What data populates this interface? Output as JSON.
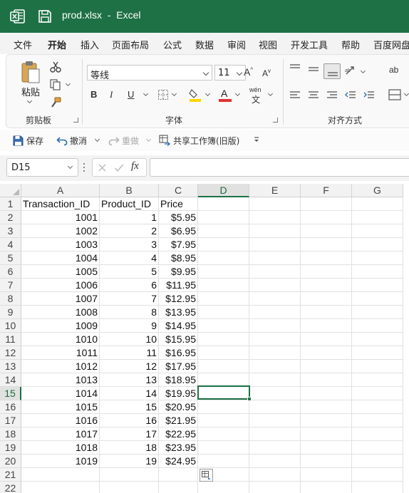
{
  "window": {
    "title": "prod.xlsx  -  Excel",
    "app_icon": "excel-icon",
    "save_icon": "save-icon"
  },
  "menu": {
    "tabs": [
      "文件",
      "开始",
      "插入",
      "页面布局",
      "公式",
      "数据",
      "审阅",
      "视图",
      "开发工具",
      "帮助",
      "百度网盘"
    ],
    "active": "开始"
  },
  "ribbon": {
    "clipboard": {
      "paste_label": "粘贴",
      "group_label": "剪贴板"
    },
    "font": {
      "font_name": "等线",
      "font_size": "11",
      "bold": "B",
      "italic": "I",
      "underline": "U",
      "grow": "A",
      "shrink": "A",
      "wen": "wén",
      "wen_char": "文",
      "group_label": "字体",
      "fill_color": "#ffd400",
      "font_color": "#e03030"
    },
    "alignment": {
      "group_label": "对齐方式",
      "wrap_label": "ab"
    }
  },
  "quick_access": {
    "save_label": "保存",
    "undo_label": "撤消",
    "redo_label": "重做",
    "share_label": "共享工作簿(旧版)"
  },
  "formula_bar": {
    "name_box": "D15",
    "fx_label": "fx",
    "formula": ""
  },
  "sheet": {
    "columns": [
      "A",
      "B",
      "C",
      "D",
      "E",
      "F",
      "G"
    ],
    "selected_column": "D",
    "selected_row": 15,
    "selected_cell": "D15",
    "rows": [
      [
        "Transaction_ID",
        "Product_ID",
        "Price"
      ],
      [
        "1001",
        "1",
        "$5.95"
      ],
      [
        "1002",
        "2",
        "$6.95"
      ],
      [
        "1003",
        "3",
        "$7.95"
      ],
      [
        "1004",
        "4",
        "$8.95"
      ],
      [
        "1005",
        "5",
        "$9.95"
      ],
      [
        "1006",
        "6",
        "$11.95"
      ],
      [
        "1007",
        "7",
        "$12.95"
      ],
      [
        "1008",
        "8",
        "$13.95"
      ],
      [
        "1009",
        "9",
        "$14.95"
      ],
      [
        "1010",
        "10",
        "$15.95"
      ],
      [
        "1011",
        "11",
        "$16.95"
      ],
      [
        "1012",
        "12",
        "$17.95"
      ],
      [
        "1013",
        "13",
        "$18.95"
      ],
      [
        "1014",
        "14",
        "$19.95"
      ],
      [
        "1015",
        "15",
        "$20.95"
      ],
      [
        "1016",
        "16",
        "$21.95"
      ],
      [
        "1017",
        "17",
        "$22.95"
      ],
      [
        "1018",
        "18",
        "$23.95"
      ],
      [
        "1019",
        "19",
        "$24.95"
      ],
      [
        "",
        "",
        ""
      ],
      [
        "",
        "",
        ""
      ]
    ]
  }
}
